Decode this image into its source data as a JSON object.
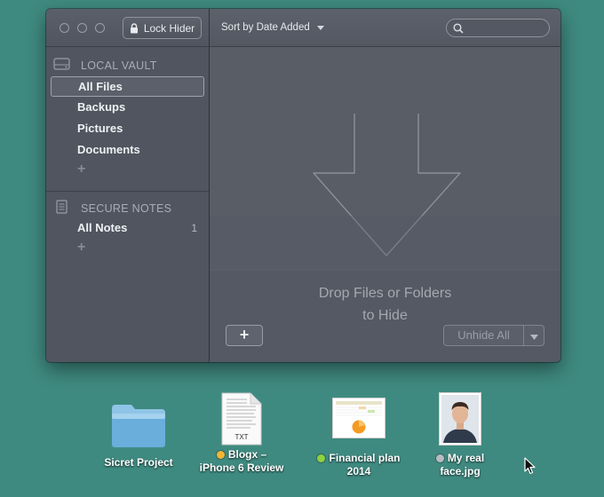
{
  "window": {
    "lock_button_label": "Lock Hider",
    "sort_label": "Sort by Date Added",
    "search_placeholder": ""
  },
  "sidebar": {
    "local_vault": {
      "title": "LOCAL VAULT",
      "items": [
        {
          "label": "All Files",
          "selected": true
        },
        {
          "label": "Backups"
        },
        {
          "label": "Pictures"
        },
        {
          "label": "Documents"
        }
      ],
      "add_label": "+"
    },
    "secure_notes": {
      "title": "SECURE NOTES",
      "items": [
        {
          "label": "All Notes",
          "count": "1"
        }
      ],
      "add_label": "+"
    }
  },
  "main": {
    "drop_line1": "Drop Files or Folders",
    "drop_line2": "to Hide",
    "add_button_label": "+",
    "unhide_button_label": "Unhide All"
  },
  "desktop": {
    "items": [
      {
        "name": "Sicret Project",
        "type": "folder",
        "tag": ""
      },
      {
        "line1": "Blogx –",
        "line2": "iPhone 6 Review",
        "type": "text",
        "tag_color": "#f2b632",
        "icon_label": "TXT"
      },
      {
        "line1": "Financial plan",
        "line2": "2014",
        "type": "spreadsheet",
        "tag_color": "#8fd13f"
      },
      {
        "line1": "My real",
        "line2": "face.jpg",
        "type": "photo",
        "tag_color": "#b9bcc0"
      }
    ]
  },
  "colors": {
    "desktop": "#3f8a80",
    "window": "#585d66",
    "sidebar": "#50555f"
  }
}
